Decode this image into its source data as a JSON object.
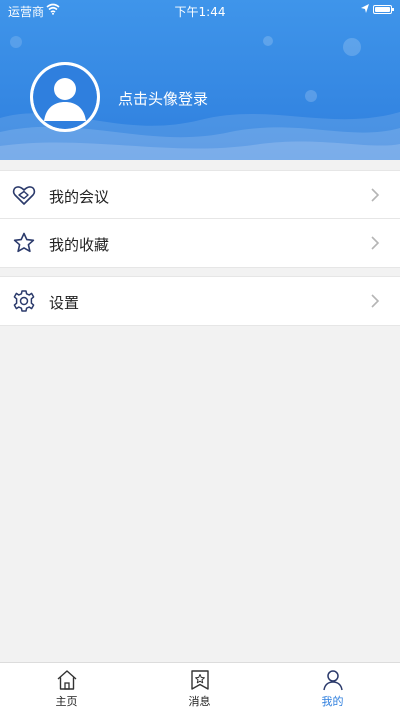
{
  "status_bar": {
    "carrier": "运营商",
    "time": "下午1:44"
  },
  "profile": {
    "login_prompt": "点击头像登录"
  },
  "menu_groups": [
    {
      "items": [
        {
          "label": "我的会议",
          "icon": "meeting-heart-icon"
        },
        {
          "label": "我的收藏",
          "icon": "star-icon"
        }
      ]
    },
    {
      "items": [
        {
          "label": "设置",
          "icon": "gear-icon"
        }
      ]
    }
  ],
  "tabbar": {
    "tabs": [
      {
        "label": "主页",
        "icon": "home-icon"
      },
      {
        "label": "消息",
        "icon": "message-bookmark-icon"
      },
      {
        "label": "我的",
        "icon": "person-icon"
      }
    ],
    "active_index": 2
  },
  "colors": {
    "header_blue": "#2f7fde",
    "active_tab": "#2f7fde",
    "icon_dark": "#2b3a6b",
    "background": "#f2f2f2"
  }
}
